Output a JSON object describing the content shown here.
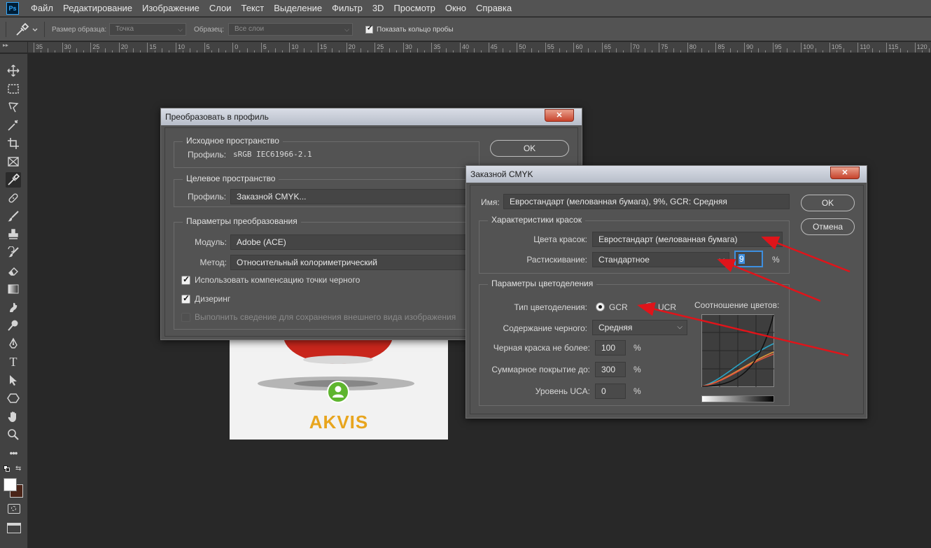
{
  "app": {
    "logo": "Ps",
    "menu": [
      "Файл",
      "Редактирование",
      "Изображение",
      "Слои",
      "Текст",
      "Выделение",
      "Фильтр",
      "3D",
      "Просмотр",
      "Окно",
      "Справка"
    ]
  },
  "options_bar": {
    "sample_size_label": "Размер образца:",
    "sample_size_value": "Точка",
    "sample_label": "Образец:",
    "sample_value": "Все слои",
    "show_ring_label": "Показать кольцо пробы",
    "show_ring_checked": true
  },
  "ruler": {
    "labels": [
      "35",
      "30",
      "25",
      "20",
      "15",
      "10",
      "5",
      "0",
      "5",
      "10",
      "15",
      "20",
      "25",
      "30",
      "35",
      "40",
      "45",
      "50",
      "55",
      "60",
      "65",
      "70",
      "75",
      "80",
      "85",
      "90",
      "95",
      "100",
      "105",
      "110",
      "115",
      "120"
    ]
  },
  "toolbar": {
    "tools": [
      "move-tool",
      "marquee-tool",
      "lasso-tool",
      "magic-wand-tool",
      "crop-tool",
      "frame-tool",
      "eyedropper-tool",
      "healing-tool",
      "brush-tool",
      "stamp-tool",
      "history-brush-tool",
      "eraser-tool",
      "gradient-tool",
      "smudge-tool",
      "dodge-tool",
      "pen-tool",
      "type-tool",
      "path-select-tool",
      "shape-tool",
      "hand-tool",
      "zoom-tool",
      "more-tools"
    ],
    "active": "eyedropper-tool",
    "type_glyph": "T",
    "more_glyph": "•••",
    "foreground_color": "#ffffff",
    "background_color": "#4a2418"
  },
  "canvas": {
    "logo_text": "AKVIS",
    "logo_color": "#e8a51e"
  },
  "convert_dialog": {
    "title": "Преобразовать в профиль",
    "close": "✕",
    "source_group": "Исходное пространство",
    "source_profile_label": "Профиль:",
    "source_profile_value": "sRGB IEC61966-2.1",
    "target_group": "Целевое пространство",
    "target_profile_label": "Профиль:",
    "target_profile_value": "Заказной CMYK...",
    "params_group": "Параметры преобразования",
    "engine_label": "Модуль:",
    "engine_value": "Adobe (ACE)",
    "intent_label": "Метод:",
    "intent_value": "Относительный колориметрический",
    "bpc_label": "Использовать компенсацию точки черного",
    "bpc_checked": true,
    "dither_label": "Дизеринг",
    "dither_checked": true,
    "flatten_label": "Выполнить сведение для сохранения внешнего вида изображения",
    "flatten_checked": false,
    "ok_label": "OK"
  },
  "cmyk_dialog": {
    "title": "Заказной CMYK",
    "close": "✕",
    "name_label": "Имя:",
    "name_value": "Евростандарт (мелованная бумага), 9%, GCR: Средняя",
    "ok_label": "OK",
    "cancel_label": "Отмена",
    "ink_group": "Характеристики красок",
    "ink_colors_label": "Цвета красок:",
    "ink_colors_value": "Евростандарт (мелованная бумага)",
    "dot_gain_label": "Растискивание:",
    "dot_gain_value": "Стандартное",
    "dot_gain_percent_value": "9",
    "percent": "%",
    "sep_group": "Параметры цветоделения",
    "sep_type_label": "Тип цветоделения:",
    "gcr_label": "GCR",
    "ucr_label": "UCR",
    "sep_type_selected": "GCR",
    "black_gen_label": "Содержание черного:",
    "black_gen_value": "Средняя",
    "black_limit_label": "Черная краска не более:",
    "black_limit_value": "100",
    "total_ink_label": "Суммарное покрытие до:",
    "total_ink_value": "300",
    "uca_label": "Уровень UCA:",
    "uca_value": "0",
    "graph_label": "Соотношение цветов:",
    "graph_colors": {
      "cyan": "#2aa6c8",
      "magenta": "#e0523c",
      "yellow": "#e09a3c",
      "black": "#111111"
    },
    "arrow_color": "#e0141a"
  }
}
